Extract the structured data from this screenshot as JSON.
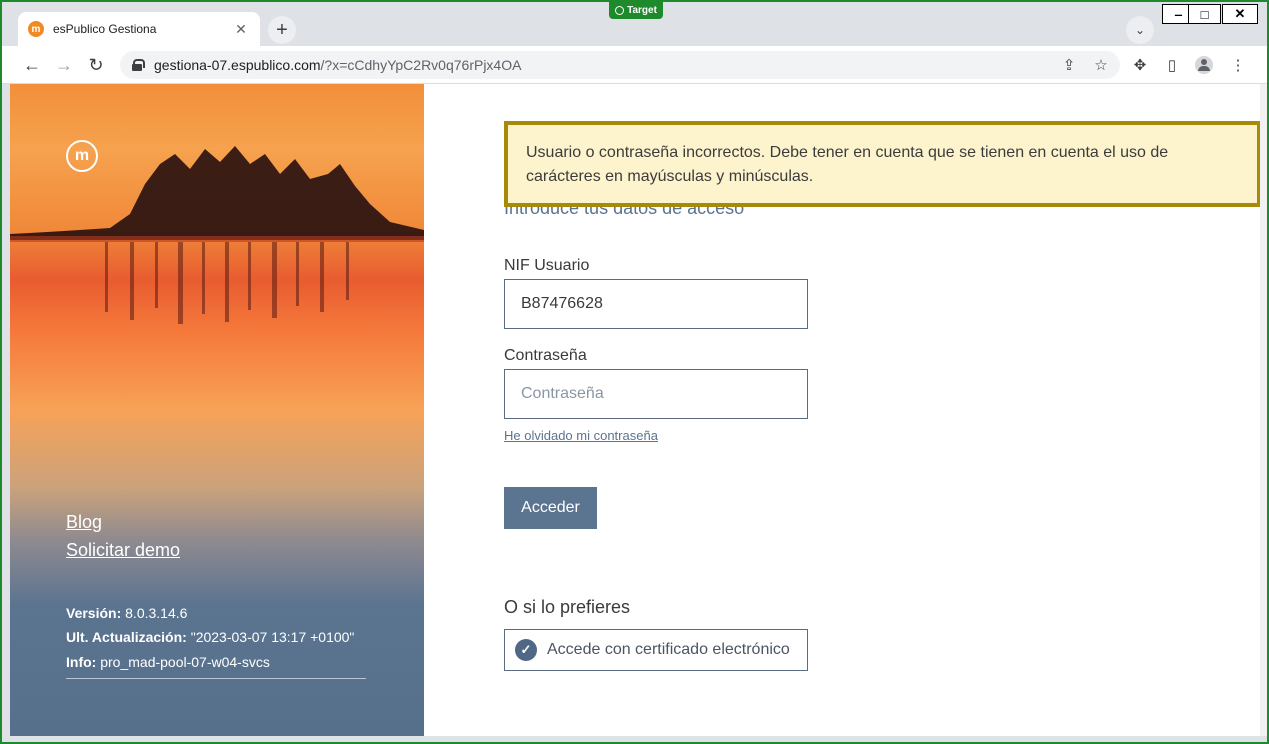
{
  "browser": {
    "tab_title": "esPublico Gestiona",
    "tab_close": "✕",
    "new_tab": "+",
    "target_badge": "Target",
    "url_host": "gestiona-07.espublico.com",
    "url_rest": "/?x=cCdhyYpC2Rv0q76rPjx4OA",
    "icons": [
      "back-icon",
      "forward-icon",
      "reload-icon",
      "lock-icon",
      "share-icon",
      "star-icon",
      "extensions-icon",
      "sidepanel-icon",
      "profile-icon",
      "menu-icon",
      "tab-search-icon"
    ],
    "window_controls": {
      "minimize": "‒",
      "maximize": "□",
      "close": "✕"
    }
  },
  "hero": {
    "links": {
      "blog": "Blog",
      "demo": "Solicitar demo"
    },
    "meta": {
      "version_label": "Versión:",
      "version_value": "8.0.3.14.6",
      "update_label": "Ult. Actualización:",
      "update_value": "\"2023-03-07 13:17 +0100\"",
      "info_label": "Info:",
      "info_value": "pro_mad-pool-07-w04-svcs"
    }
  },
  "login": {
    "alert": "Usuario o contraseña incorrectos. Debe tener en cuenta que se tienen en cuenta el uso de carácteres en mayúsculas y minúsculas.",
    "heading": "Introduce tus datos de acceso",
    "nif_label": "NIF Usuario",
    "nif_value": "B87476628",
    "password_label": "Contraseña",
    "password_placeholder": "Contraseña",
    "forgot_link": "He olvidado mi contraseña",
    "submit": "Acceder",
    "alt_heading": "O si lo prefieres",
    "cert_button": "Accede con certificado electrónico"
  },
  "colors": {
    "accent": "#5b7490",
    "alert_bg": "#fdf3cd",
    "alert_border": "#a88a0a",
    "frame": "#1f8a2c"
  }
}
